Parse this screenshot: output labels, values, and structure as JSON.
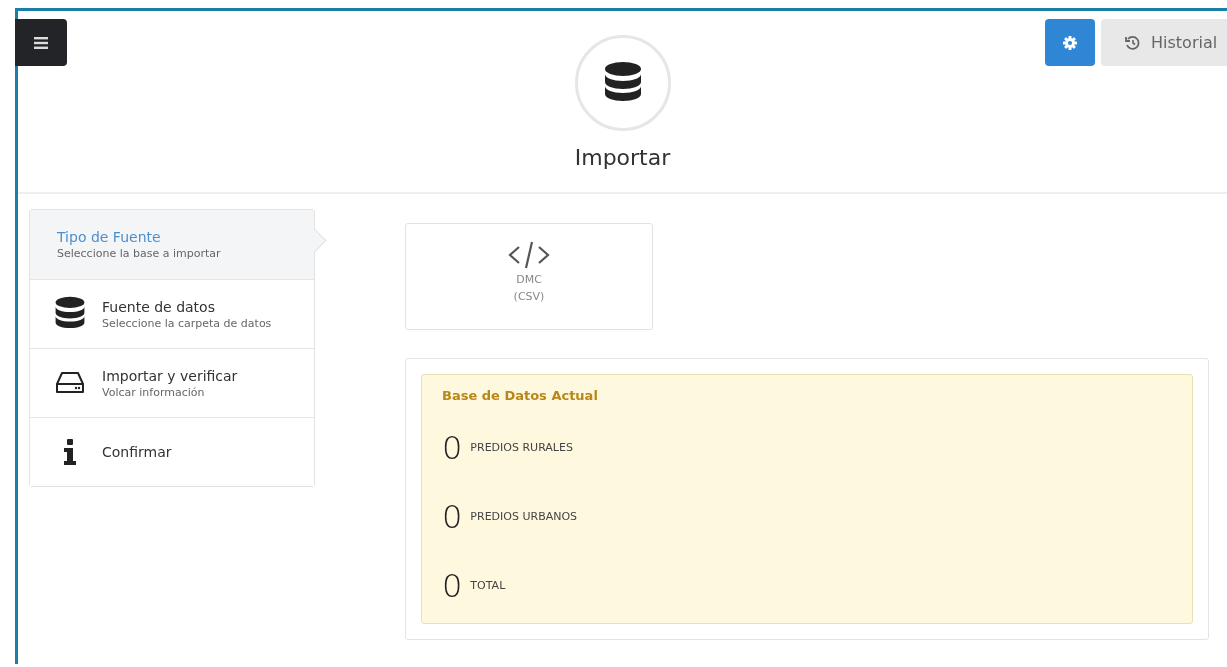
{
  "header": {
    "title": "Importar",
    "buttons": [
      {
        "kind": "settings"
      },
      {
        "kind": "history",
        "label": "Historial"
      }
    ]
  },
  "steps": [
    {
      "kind": "plain",
      "title": "Tipo de Fuente",
      "subtitle": "Seleccione la base a importar",
      "selected": true
    },
    {
      "kind": "database",
      "title": "Fuente de datos",
      "subtitle": "Seleccione la carpeta de datos",
      "selected": false
    },
    {
      "kind": "drive",
      "title": "Importar y verificar",
      "subtitle": "Volcar información",
      "selected": false
    },
    {
      "kind": "info",
      "title": "Confirmar",
      "selected": false
    }
  ],
  "source_card": {
    "name": "DMC",
    "format": "(CSV)"
  },
  "summary": {
    "title": "Base de Datos Actual",
    "stats": [
      {
        "value": "0",
        "label": "PREDIOS RURALES"
      },
      {
        "value": "0",
        "label": "PREDIOS URBANOS"
      },
      {
        "value": "0",
        "label": "TOTAL"
      }
    ]
  }
}
